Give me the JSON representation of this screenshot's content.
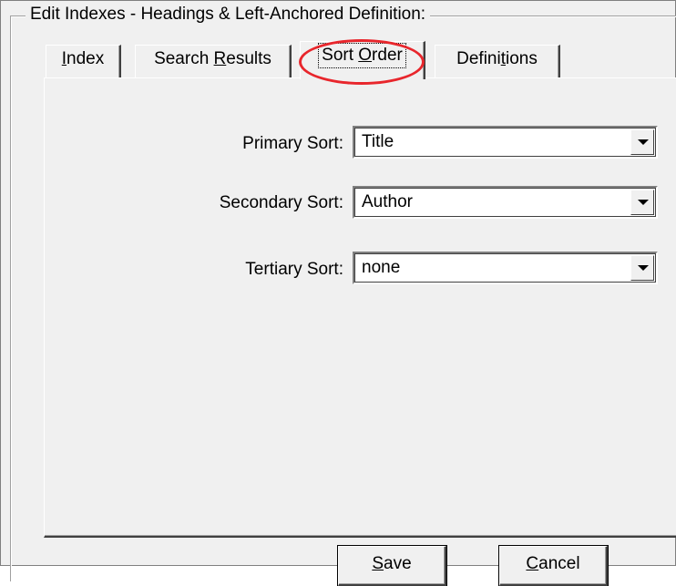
{
  "group": {
    "title": "Edit Indexes - Headings & Left-Anchored Definition:"
  },
  "tabs": [
    {
      "label": "Index",
      "underline": "I",
      "rest": "ndex"
    },
    {
      "label": "Search Results",
      "pre": "Search ",
      "underline": "R",
      "rest": "esults"
    },
    {
      "label": "Sort Order",
      "pre": "Sort ",
      "underline": "O",
      "rest": "rder",
      "active": true
    },
    {
      "label": "Definitions",
      "pre": "Defini",
      "underline": "t",
      "rest": "ions"
    }
  ],
  "sort": {
    "primary": {
      "label": "Primary Sort:",
      "value": "Title"
    },
    "secondary": {
      "label": "Secondary Sort:",
      "value": "Author"
    },
    "tertiary": {
      "label": "Tertiary Sort:",
      "value": "none"
    }
  },
  "buttons": {
    "save": {
      "label": "Save",
      "underline": "S",
      "rest": "ave"
    },
    "cancel": {
      "label": "Cancel",
      "underline": "C",
      "rest": "ancel"
    }
  },
  "colors": {
    "highlight": "#e8262c",
    "face": "#f0f0f0"
  }
}
